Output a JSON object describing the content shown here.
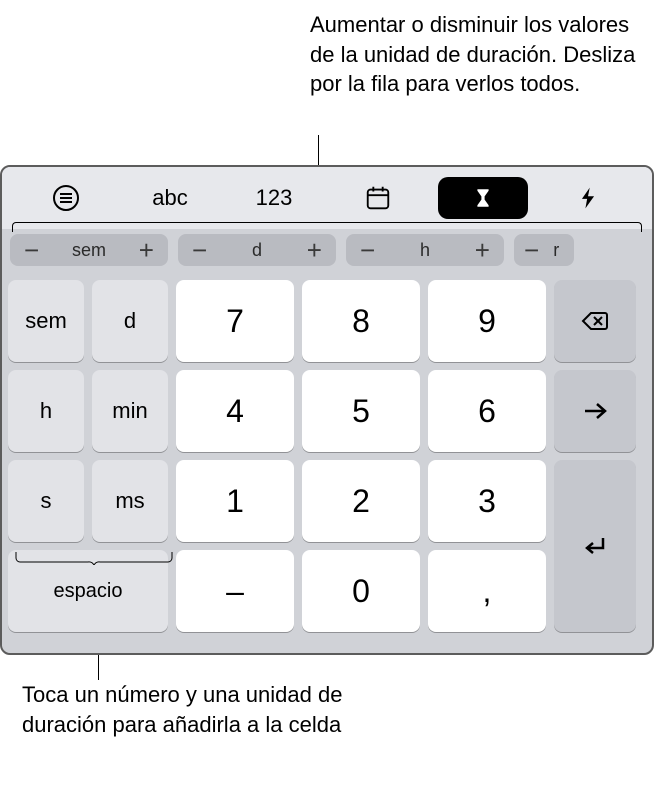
{
  "callout_top": "Aumentar o disminuir los valores de la unidad de duración. Desliza por la fila para verlos todos.",
  "callout_bottom": "Toca un número y una unidad de duración para añadirla a la celda",
  "toolbar": {
    "abc": "abc",
    "num": "123"
  },
  "steppers": [
    {
      "minus": "−",
      "label": "sem",
      "plus": "+"
    },
    {
      "minus": "−",
      "label": "d",
      "plus": "+"
    },
    {
      "minus": "−",
      "label": "h",
      "plus": "+"
    },
    {
      "minus": "−",
      "label": "r",
      "plus": ""
    }
  ],
  "keys": {
    "units": [
      "sem",
      "d",
      "h",
      "min",
      "s",
      "ms"
    ],
    "nums": [
      "7",
      "8",
      "9",
      "4",
      "5",
      "6",
      "1",
      "2",
      "3",
      "–",
      "0",
      ","
    ],
    "space": "espacio"
  }
}
